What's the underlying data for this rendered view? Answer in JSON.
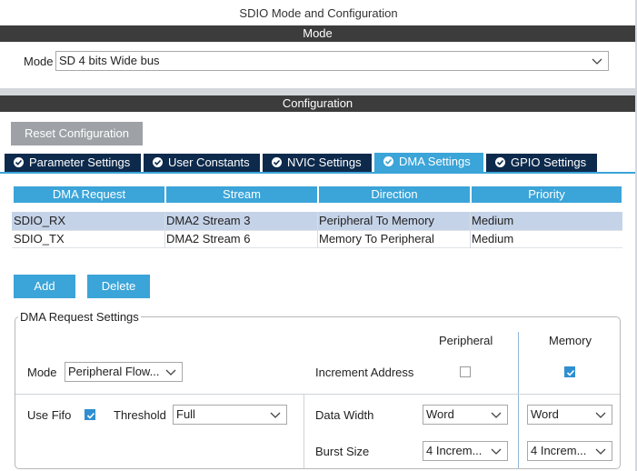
{
  "window": {
    "title": "SDIO Mode and Configuration"
  },
  "mode_section": {
    "header": "Mode",
    "mode_label": "Mode",
    "mode_value": "SD 4 bits Wide bus"
  },
  "config_section": {
    "header": "Configuration",
    "reset_button": "Reset Configuration"
  },
  "tabs": [
    {
      "label": "Parameter Settings",
      "active": false
    },
    {
      "label": "User Constants",
      "active": false
    },
    {
      "label": "NVIC Settings",
      "active": false
    },
    {
      "label": "DMA Settings",
      "active": true
    },
    {
      "label": "GPIO Settings",
      "active": false
    }
  ],
  "dma_table": {
    "headers": [
      "DMA Request",
      "Stream",
      "Direction",
      "Priority"
    ],
    "rows": [
      [
        "SDIO_RX",
        "DMA2 Stream 3",
        "Peripheral To Memory",
        "Medium"
      ],
      [
        "SDIO_TX",
        "DMA2 Stream 6",
        "Memory To Peripheral",
        "Medium"
      ]
    ],
    "selected_row": 0
  },
  "buttons": {
    "add": "Add",
    "delete": "Delete"
  },
  "request_settings": {
    "legend": "DMA Request Settings",
    "peripheral_header": "Peripheral",
    "memory_header": "Memory",
    "mode_label": "Mode",
    "mode_value": "Peripheral Flow...",
    "increment_label": "Increment Address",
    "increment_peripheral": false,
    "increment_memory": true,
    "use_fifo_label": "Use Fifo",
    "use_fifo": true,
    "threshold_label": "Threshold",
    "threshold_value": "Full",
    "data_width_label": "Data Width",
    "data_width_peripheral": "Word",
    "data_width_memory": "Word",
    "burst_size_label": "Burst Size",
    "burst_size_peripheral": "4 Increm...",
    "burst_size_memory": "4 Increm..."
  },
  "colors": {
    "accent": "#3ba4d8",
    "tab_dark": "#0d2a4c",
    "section_header": "#3c3c3c",
    "selected_row": "#c5d3e8",
    "checkbox_checked": "#2f8fd0"
  }
}
